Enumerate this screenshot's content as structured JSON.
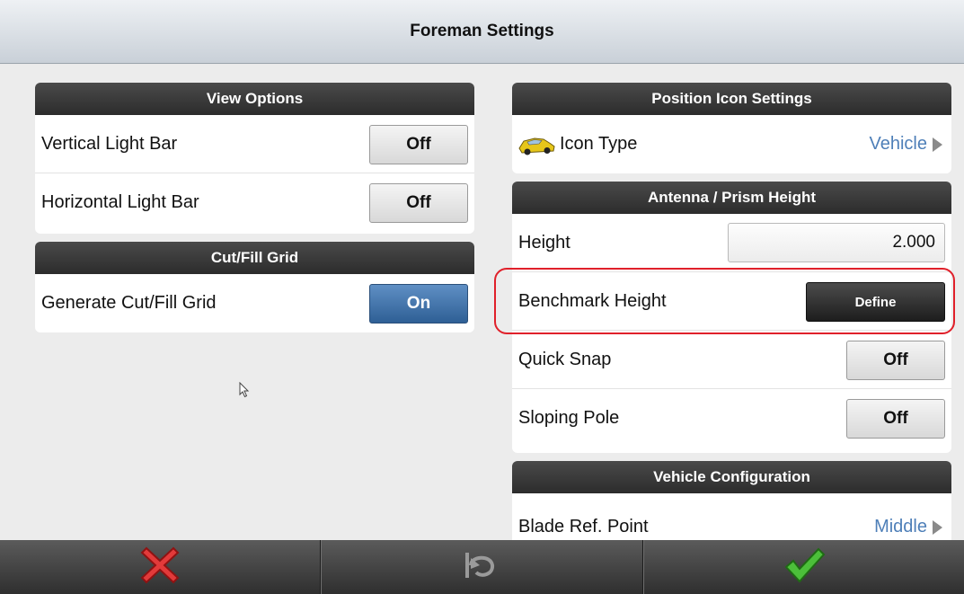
{
  "title": "Foreman Settings",
  "view_options": {
    "header": "View Options",
    "rows": [
      {
        "label": "Vertical Light Bar",
        "value": "Off"
      },
      {
        "label": "Horizontal Light Bar",
        "value": "Off"
      }
    ]
  },
  "cut_fill_grid": {
    "header": "Cut/Fill Grid",
    "rows": [
      {
        "label": "Generate Cut/Fill Grid",
        "value": "On"
      }
    ]
  },
  "position_icon": {
    "header": "Position Icon Settings",
    "icon_type_label": "Icon Type",
    "icon_type_value": "Vehicle",
    "icon": "car-icon"
  },
  "antenna": {
    "header": "Antenna / Prism Height",
    "height_label": "Height",
    "height_value": "2.000",
    "benchmark_label": "Benchmark Height",
    "define_label": "Define",
    "quick_snap_label": "Quick Snap",
    "quick_snap_value": "Off",
    "sloping_pole_label": "Sloping Pole",
    "sloping_pole_value": "Off"
  },
  "vehicle_config": {
    "header": "Vehicle Configuration",
    "blade_label": "Blade Ref. Point",
    "blade_value": "Middle"
  },
  "bottom_bar": {
    "cancel_icon": "red-x-icon",
    "undo_icon": "undo-icon",
    "confirm_icon": "green-check-icon"
  },
  "colors": {
    "on_button": "#2e5f95",
    "highlight": "#e0202a",
    "nav_value": "#4e7fb8"
  }
}
